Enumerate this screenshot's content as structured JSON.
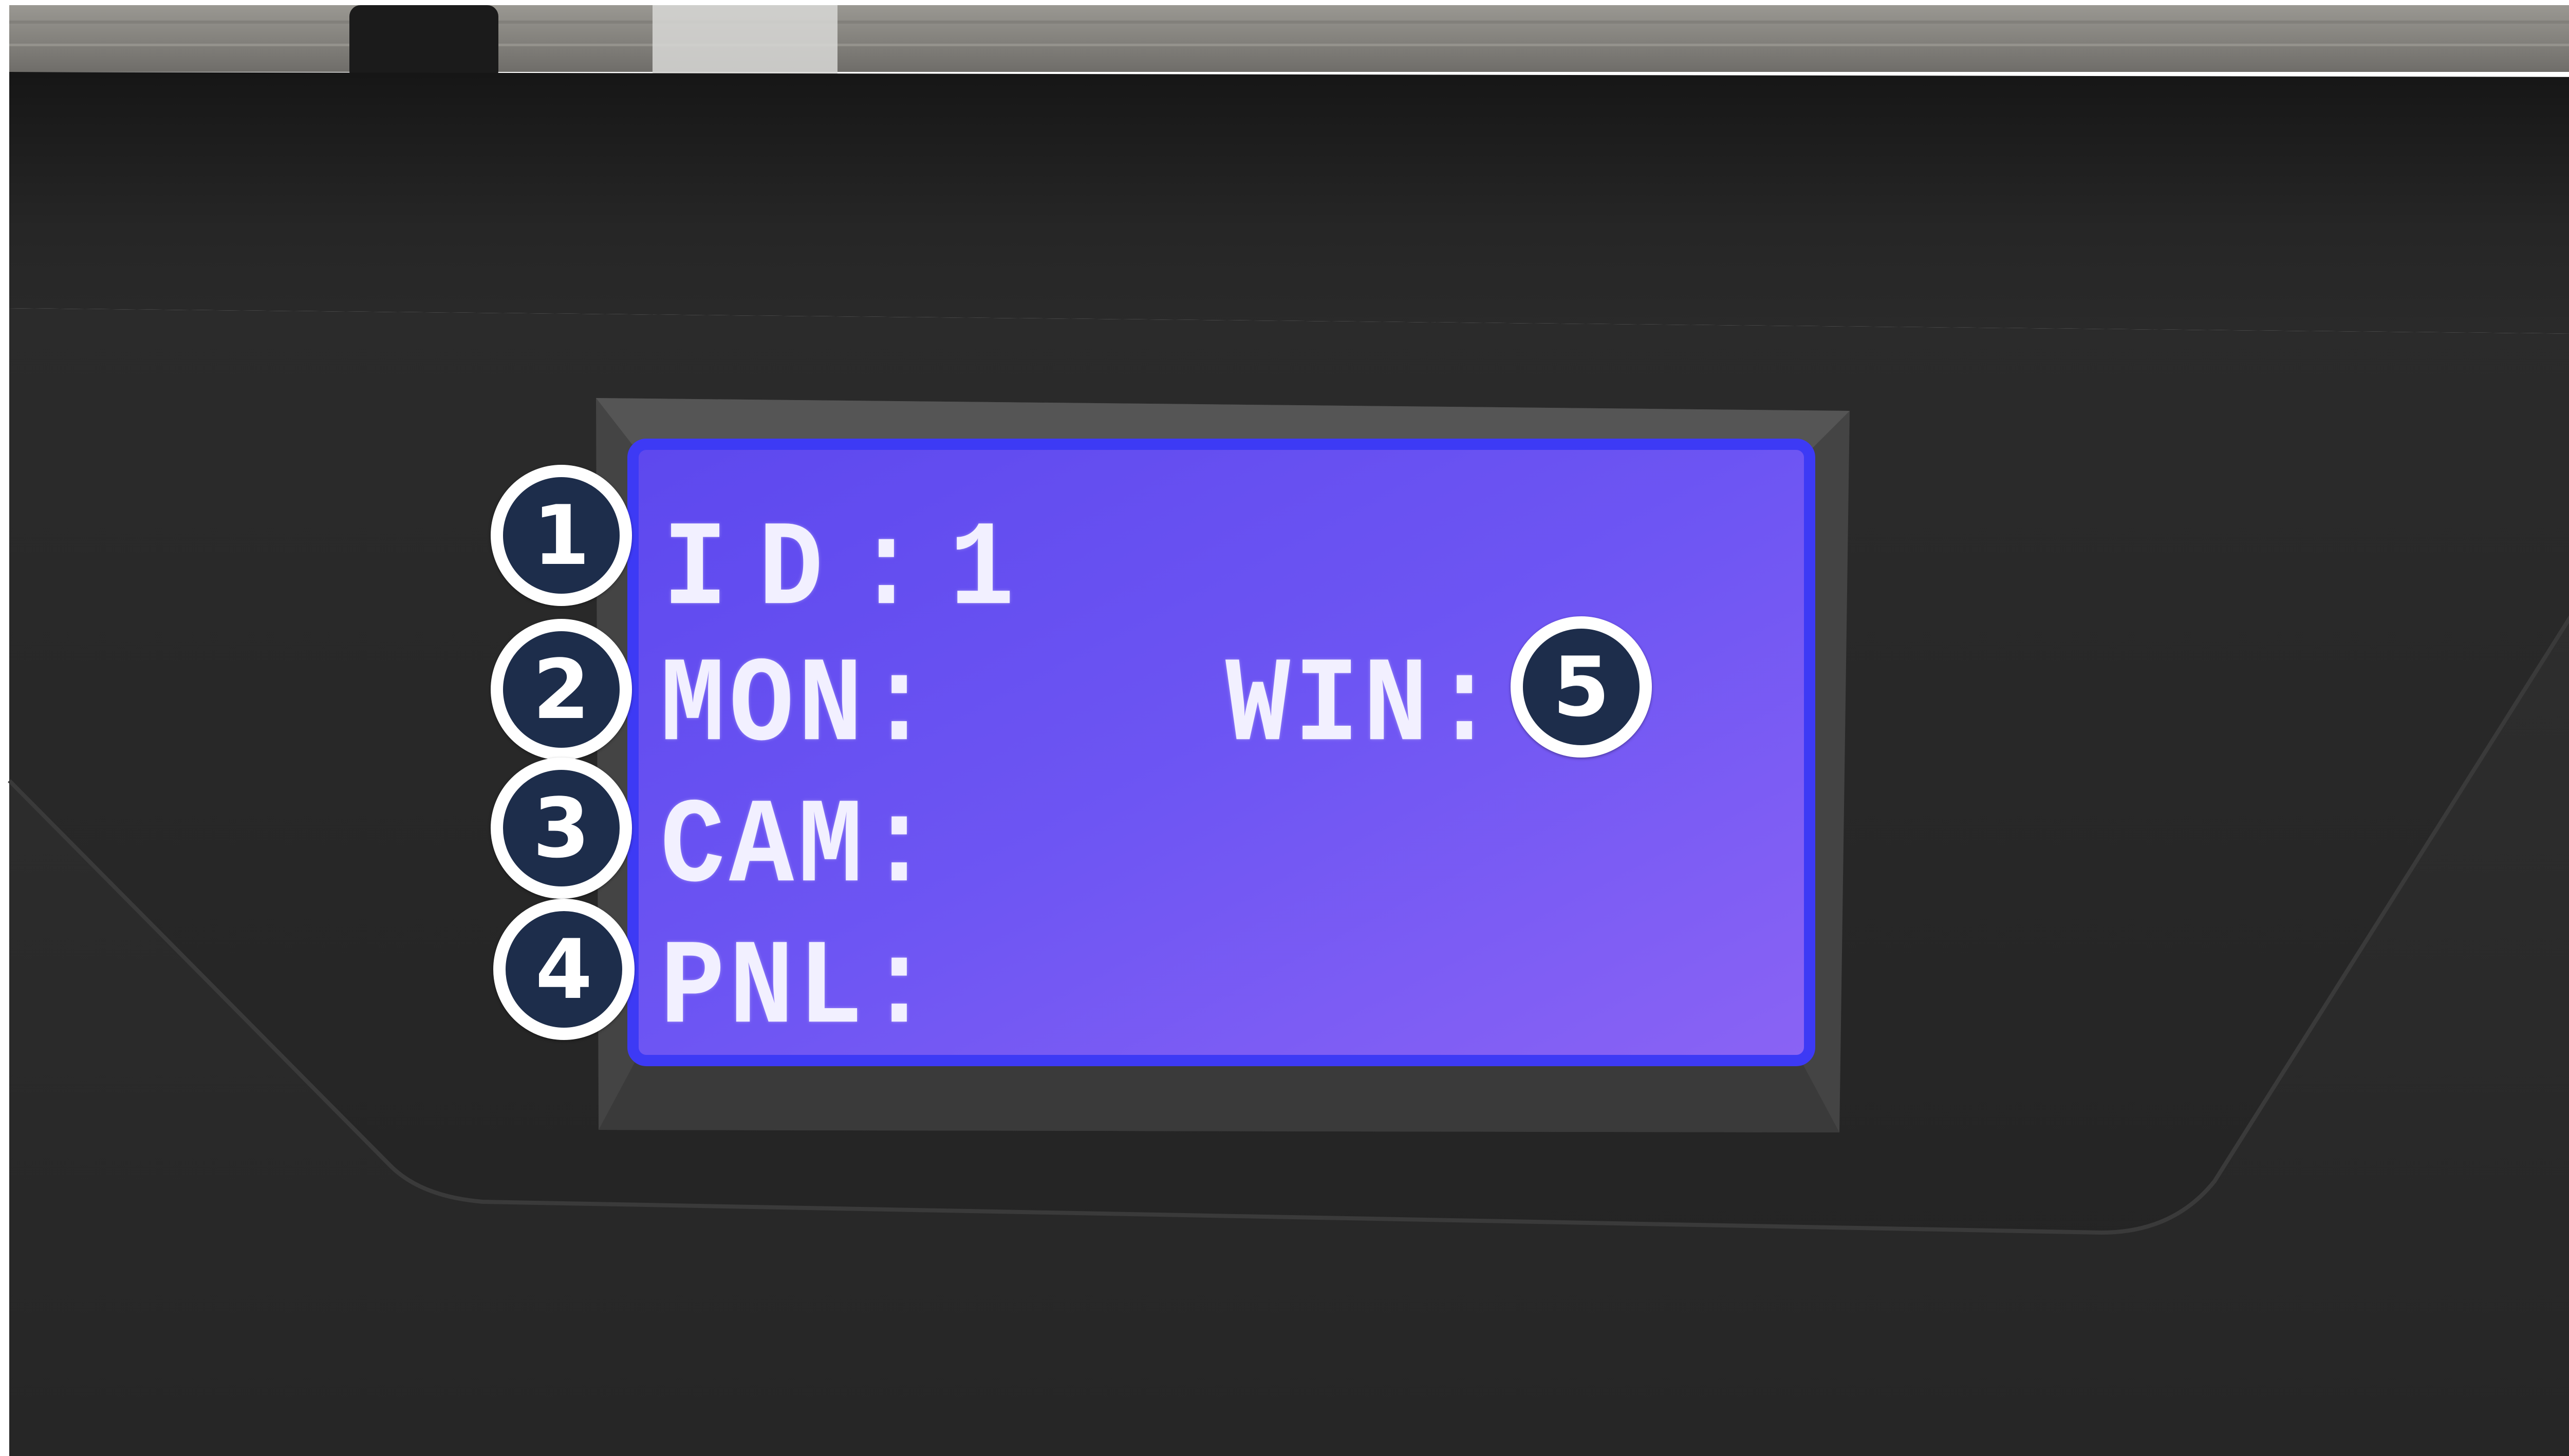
{
  "colors": {
    "wood": "#8c8c86",
    "device_body": "#262626",
    "device_top": "#1c1c1c",
    "bezel": "#4a4a4a",
    "lcd_screen": "#6b52f2",
    "lcd_text": "#f2f0ff",
    "badge_fill": "#1d2d4b",
    "badge_ring": "#ffffff"
  },
  "lcd": {
    "id_line": "ID:1",
    "mon_label": "MON:",
    "win_label": "WIN:",
    "cam_label": "CAM:",
    "pnl_label": "PNL:"
  },
  "callouts": {
    "one": "1",
    "two": "2",
    "three": "3",
    "four": "4",
    "five": "5"
  }
}
